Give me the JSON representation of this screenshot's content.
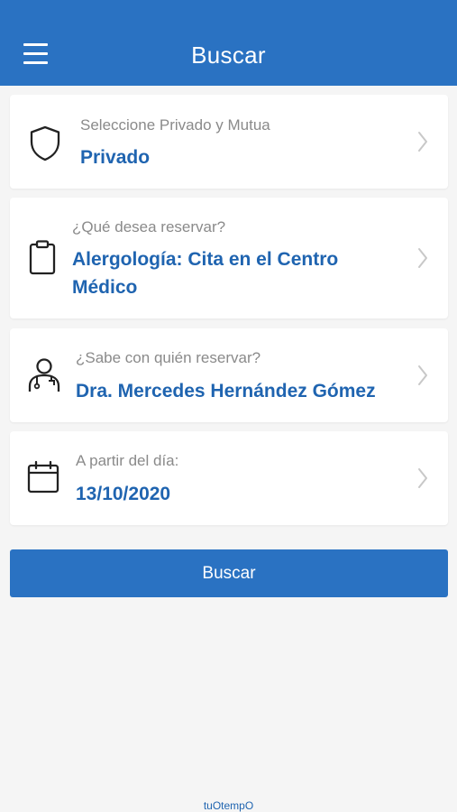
{
  "header": {
    "title": "Buscar"
  },
  "cards": [
    {
      "label": "Seleccione Privado y Mutua",
      "value": "Privado",
      "icon": "shield-icon"
    },
    {
      "label": "¿Qué desea reservar?",
      "value": "Alergología: Cita en el Centro Médico",
      "icon": "clipboard-icon"
    },
    {
      "label": "¿Sabe con quién reservar?",
      "value": "Dra. Mercedes Hernández Gómez",
      "icon": "doctor-icon"
    },
    {
      "label": "A partir del día:",
      "value": "13/10/2020",
      "icon": "calendar-icon"
    }
  ],
  "search_button": {
    "label": "Buscar"
  },
  "footer": {
    "brand": "tuOtempO"
  },
  "colors": {
    "primary": "#2a72c2",
    "value_text": "#1f64b0",
    "label_text": "#8a8a8a",
    "background": "#f5f5f5"
  }
}
